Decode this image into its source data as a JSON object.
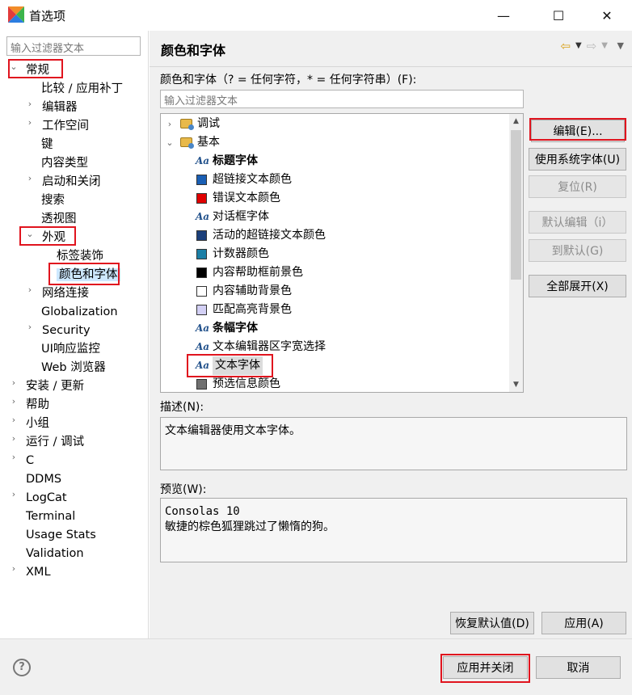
{
  "window": {
    "title": "首选项",
    "minimize_glyph": "—",
    "maximize_glyph": "☐",
    "close_glyph": "✕"
  },
  "left": {
    "filter_placeholder": "输入过滤器文本",
    "tree": [
      {
        "label": "常规",
        "twisty": "⌄"
      },
      {
        "label": "比较 / 应用补丁",
        "twisty": ""
      },
      {
        "label": "编辑器",
        "twisty": "›"
      },
      {
        "label": "工作空间",
        "twisty": "›"
      },
      {
        "label": "键",
        "twisty": ""
      },
      {
        "label": "内容类型",
        "twisty": ""
      },
      {
        "label": "启动和关闭",
        "twisty": "›"
      },
      {
        "label": "搜索",
        "twisty": ""
      },
      {
        "label": "透视图",
        "twisty": ""
      },
      {
        "label": "外观",
        "twisty": "⌄"
      },
      {
        "label": "标签装饰",
        "twisty": ""
      },
      {
        "label": "颜色和字体",
        "twisty": ""
      },
      {
        "label": "网络连接",
        "twisty": "›"
      },
      {
        "label": "Globalization",
        "twisty": ""
      },
      {
        "label": "Security",
        "twisty": "›"
      },
      {
        "label": "UI响应监控",
        "twisty": ""
      },
      {
        "label": "Web 浏览器",
        "twisty": ""
      },
      {
        "label": "安装 / 更新",
        "twisty": "›"
      },
      {
        "label": "帮助",
        "twisty": "›"
      },
      {
        "label": "小组",
        "twisty": "›"
      },
      {
        "label": "运行 / 调试",
        "twisty": "›"
      },
      {
        "label": "C",
        "twisty": "›"
      },
      {
        "label": "DDMS",
        "twisty": ""
      },
      {
        "label": "LogCat",
        "twisty": "›"
      },
      {
        "label": "Terminal",
        "twisty": ""
      },
      {
        "label": "Usage Stats",
        "twisty": ""
      },
      {
        "label": "Validation",
        "twisty": ""
      },
      {
        "label": "XML",
        "twisty": "›"
      }
    ]
  },
  "right": {
    "page_title": "颜色和字体",
    "nav_back": "⇦",
    "nav_forward": "⇨",
    "dropdown_glyph": "▼",
    "section_label": "颜色和字体（? = 任何字符，* = 任何字符串）(F):",
    "filter_placeholder": "输入过滤器文本",
    "list": [
      {
        "label": "调试",
        "kind": "folder",
        "twisty": "›"
      },
      {
        "label": "基本",
        "kind": "folder",
        "twisty": "⌄"
      },
      {
        "label": "标题字体",
        "kind": "font",
        "bold": true
      },
      {
        "label": "超链接文本颜色",
        "kind": "color",
        "color": "#1a5fb4"
      },
      {
        "label": "错误文本颜色",
        "kind": "color",
        "color": "#e00000"
      },
      {
        "label": "对话框字体",
        "kind": "font"
      },
      {
        "label": "活动的超链接文本颜色",
        "kind": "color",
        "color": "#1b3f7a"
      },
      {
        "label": "计数器颜色",
        "kind": "color",
        "color": "#1b7fa6"
      },
      {
        "label": "内容帮助框前景色",
        "kind": "color",
        "color": "#000000"
      },
      {
        "label": "内容辅助背景色",
        "kind": "color",
        "color": "#ffffff"
      },
      {
        "label": "匹配高亮背景色",
        "kind": "color",
        "color": "#d3d0f5"
      },
      {
        "label": "条幅字体",
        "kind": "font",
        "bold": true
      },
      {
        "label": "文本编辑器区字宽选择",
        "kind": "font"
      },
      {
        "label": "文本字体",
        "kind": "font",
        "selected": true
      },
      {
        "label": "预选信息颜色",
        "kind": "color",
        "color": "#707070"
      }
    ],
    "buttons": {
      "edit": "编辑(E)...",
      "use_system_font": "使用系统字体(U)",
      "reset": "复位(R)",
      "edit_default": "默认编辑（i）",
      "go_to_default": "到默认(G)",
      "expand_all": "全部展开(X)"
    },
    "description_label": "描述(N):",
    "description_text": "文本编辑器使用文本字体。",
    "preview_label": "预览(W):",
    "preview_lines": [
      "Consolas 10",
      "敏捷的棕色狐狸跳过了懒惰的狗。"
    ],
    "restore_defaults": "恢复默认值(D)",
    "apply": "应用(A)"
  },
  "bottom": {
    "help_glyph": "?",
    "apply_and_close": "应用并关闭",
    "cancel": "取消"
  },
  "colors": {
    "highlight_red": "#e0141e",
    "selection_blue": "#cde8ff"
  }
}
